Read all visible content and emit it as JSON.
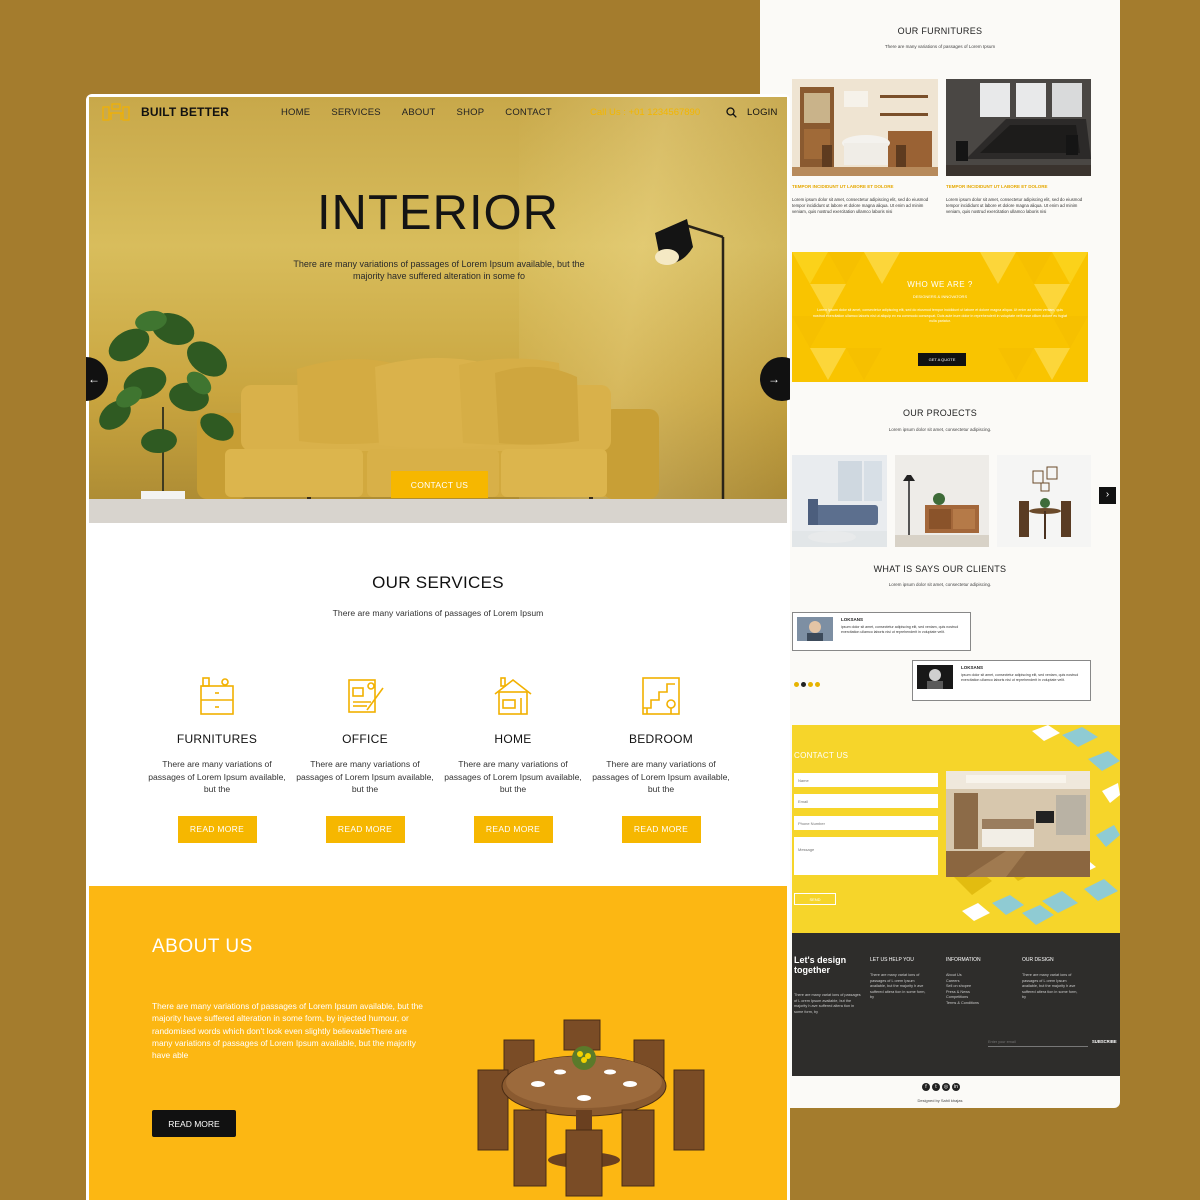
{
  "brand": {
    "name": "BUILT BETTER"
  },
  "nav": {
    "links": [
      "HOME",
      "SERVICES",
      "ABOUT",
      "SHOP",
      "CONTACT"
    ],
    "call": "Call Us : +01 1234567890",
    "login": "LOGIN"
  },
  "hero": {
    "title": "INTERIOR",
    "subtitle": "There are many variations of passages of Lorem Ipsum available, but the majority have suffered alteration in some fo",
    "cta": "CONTACT US",
    "prev_arrow": "←",
    "next_arrow": "→"
  },
  "services": {
    "title": "OUR SERVICES",
    "subtitle": "There are many variations of passages of Lorem Ipsum",
    "items": [
      {
        "icon": "furniture-cabinet-icon",
        "title": "FURNITURES",
        "text": "There are many variations of passages of Lorem Ipsum available, but the",
        "button": "READ MORE"
      },
      {
        "icon": "office-blueprint-icon",
        "title": "OFFICE",
        "text": "There are many variations of passages of Lorem Ipsum available, but the",
        "button": "READ MORE"
      },
      {
        "icon": "home-house-icon",
        "title": "HOME",
        "text": "There are many variations of passages of Lorem Ipsum available, but the",
        "button": "READ MORE"
      },
      {
        "icon": "bedroom-stairs-icon",
        "title": "BEDROOM",
        "text": "There are many variations of passages of Lorem Ipsum available, but the",
        "button": "READ MORE"
      }
    ]
  },
  "about": {
    "title": "ABOUT US",
    "body": "There are many variations of passages of Lorem Ipsum available, but the majority have suffered alteration in some form, by injected humour, or randomised words which don't look even slightly believableThere are many variations of passages of Lorem Ipsum available, but the majority have able",
    "button": "READ MORE"
  },
  "right": {
    "furnitures": {
      "title": "OUR FURNITURES",
      "subtitle": "There are many variations of passages of Lorem Ipsum",
      "cards": [
        {
          "head": "TEMPOR INCIDIDUNT UT LABORE ET DOLORE",
          "text": "Lorem ipsum dolor sit amet, consectetur adipiscing elit, sed do eiusmod tempor incididunt ut labore et dolore magna aliqua. Ut enim ad minim veniam, quis nostrud exercitation ullamco laboris nisi"
        },
        {
          "head": "TEMPOR INCIDIDUNT UT LABORE ET DOLORE",
          "text": "Lorem ipsum dolor sit amet, consectetur adipiscing elit, sed do eiusmod tempor incididunt ut labore et dolore magna aliqua. Ut enim ad minim veniam, quis nostrud exercitation ullamco laboris nisi"
        }
      ]
    },
    "who": {
      "title": "WHO WE ARE ?",
      "subtitle": "DESIGNERS & INNOVATORS",
      "body": "Lorem ipsum dolor sit amet, consectetur adipiscing elit, sed do eiusmod tempor incididunt ut labore et dolore magna aliqua. Ut enim ad minim veniam, quis nostrud exercitation ullamco laboris nisi ut aliquip ex ea commodo consequat. Duis aute irure dolor in reprehenderit in voluptate velit esse cillum dolore eu fugiat nulla pariatur.",
      "button": "GET A QUOTE"
    },
    "projects": {
      "title": "OUR PROJECTS",
      "subtitle": "Lorem ipsum dolor sit amet, consectetur adipiscing.",
      "next": "›"
    },
    "clients": {
      "title": "WHAT IS SAYS OUR CLIENTS",
      "subtitle": "Lorem ipsum dolor sit amet, consectetur adipiscing.",
      "items": [
        {
          "name": "LOKSANS",
          "text": "ipsum dolor sit amet, consectetur adipiscing elit, sed veniam, quis nostrud exercitation ullamco laboris nisi ut reprehenderit in voluptate velit."
        },
        {
          "name": "LOKSANS",
          "text": "ipsum dolor sit amet, consectetur adipiscing elit, sed veniam, quis nostrud exercitation ullamco laboris nisi ut reprehenderit in voluptate velit."
        }
      ]
    },
    "contact": {
      "title": "CONTACT US",
      "name_ph": "Name",
      "email_ph": "Email",
      "phone_ph": "Phone Number",
      "message_ph": "Message",
      "send": "SEND"
    },
    "footer": {
      "brand": "Let's design together",
      "brand_text": "There are many variat ions of passages of L orem Ipsum available, but the majority h ave suffered altera tion in some form, by",
      "col1_head": "LET US HELP YOU",
      "col1_text": "There are many variat ions of passages of L orem Ipsum available, but the majority h ave suffered altera tion in some form, by",
      "col2_head": "INFORMATION",
      "col2_links": [
        "About Us",
        "Careers",
        "Sell on shopee",
        "Press & News",
        "Competitions",
        "Terms & Conditions"
      ],
      "col3_head": "OUR DESIGN",
      "col3_text": "There are many variat ions of passages of L orem Ipsum available, but the majority h ave suffered altera tion in some form, by",
      "email_ph": "Enter your email",
      "subscribe": "SUBSCRIBE"
    },
    "social": [
      "f",
      "t",
      "◎",
      "in"
    ],
    "credit": "Designed by Sahil khajas"
  }
}
